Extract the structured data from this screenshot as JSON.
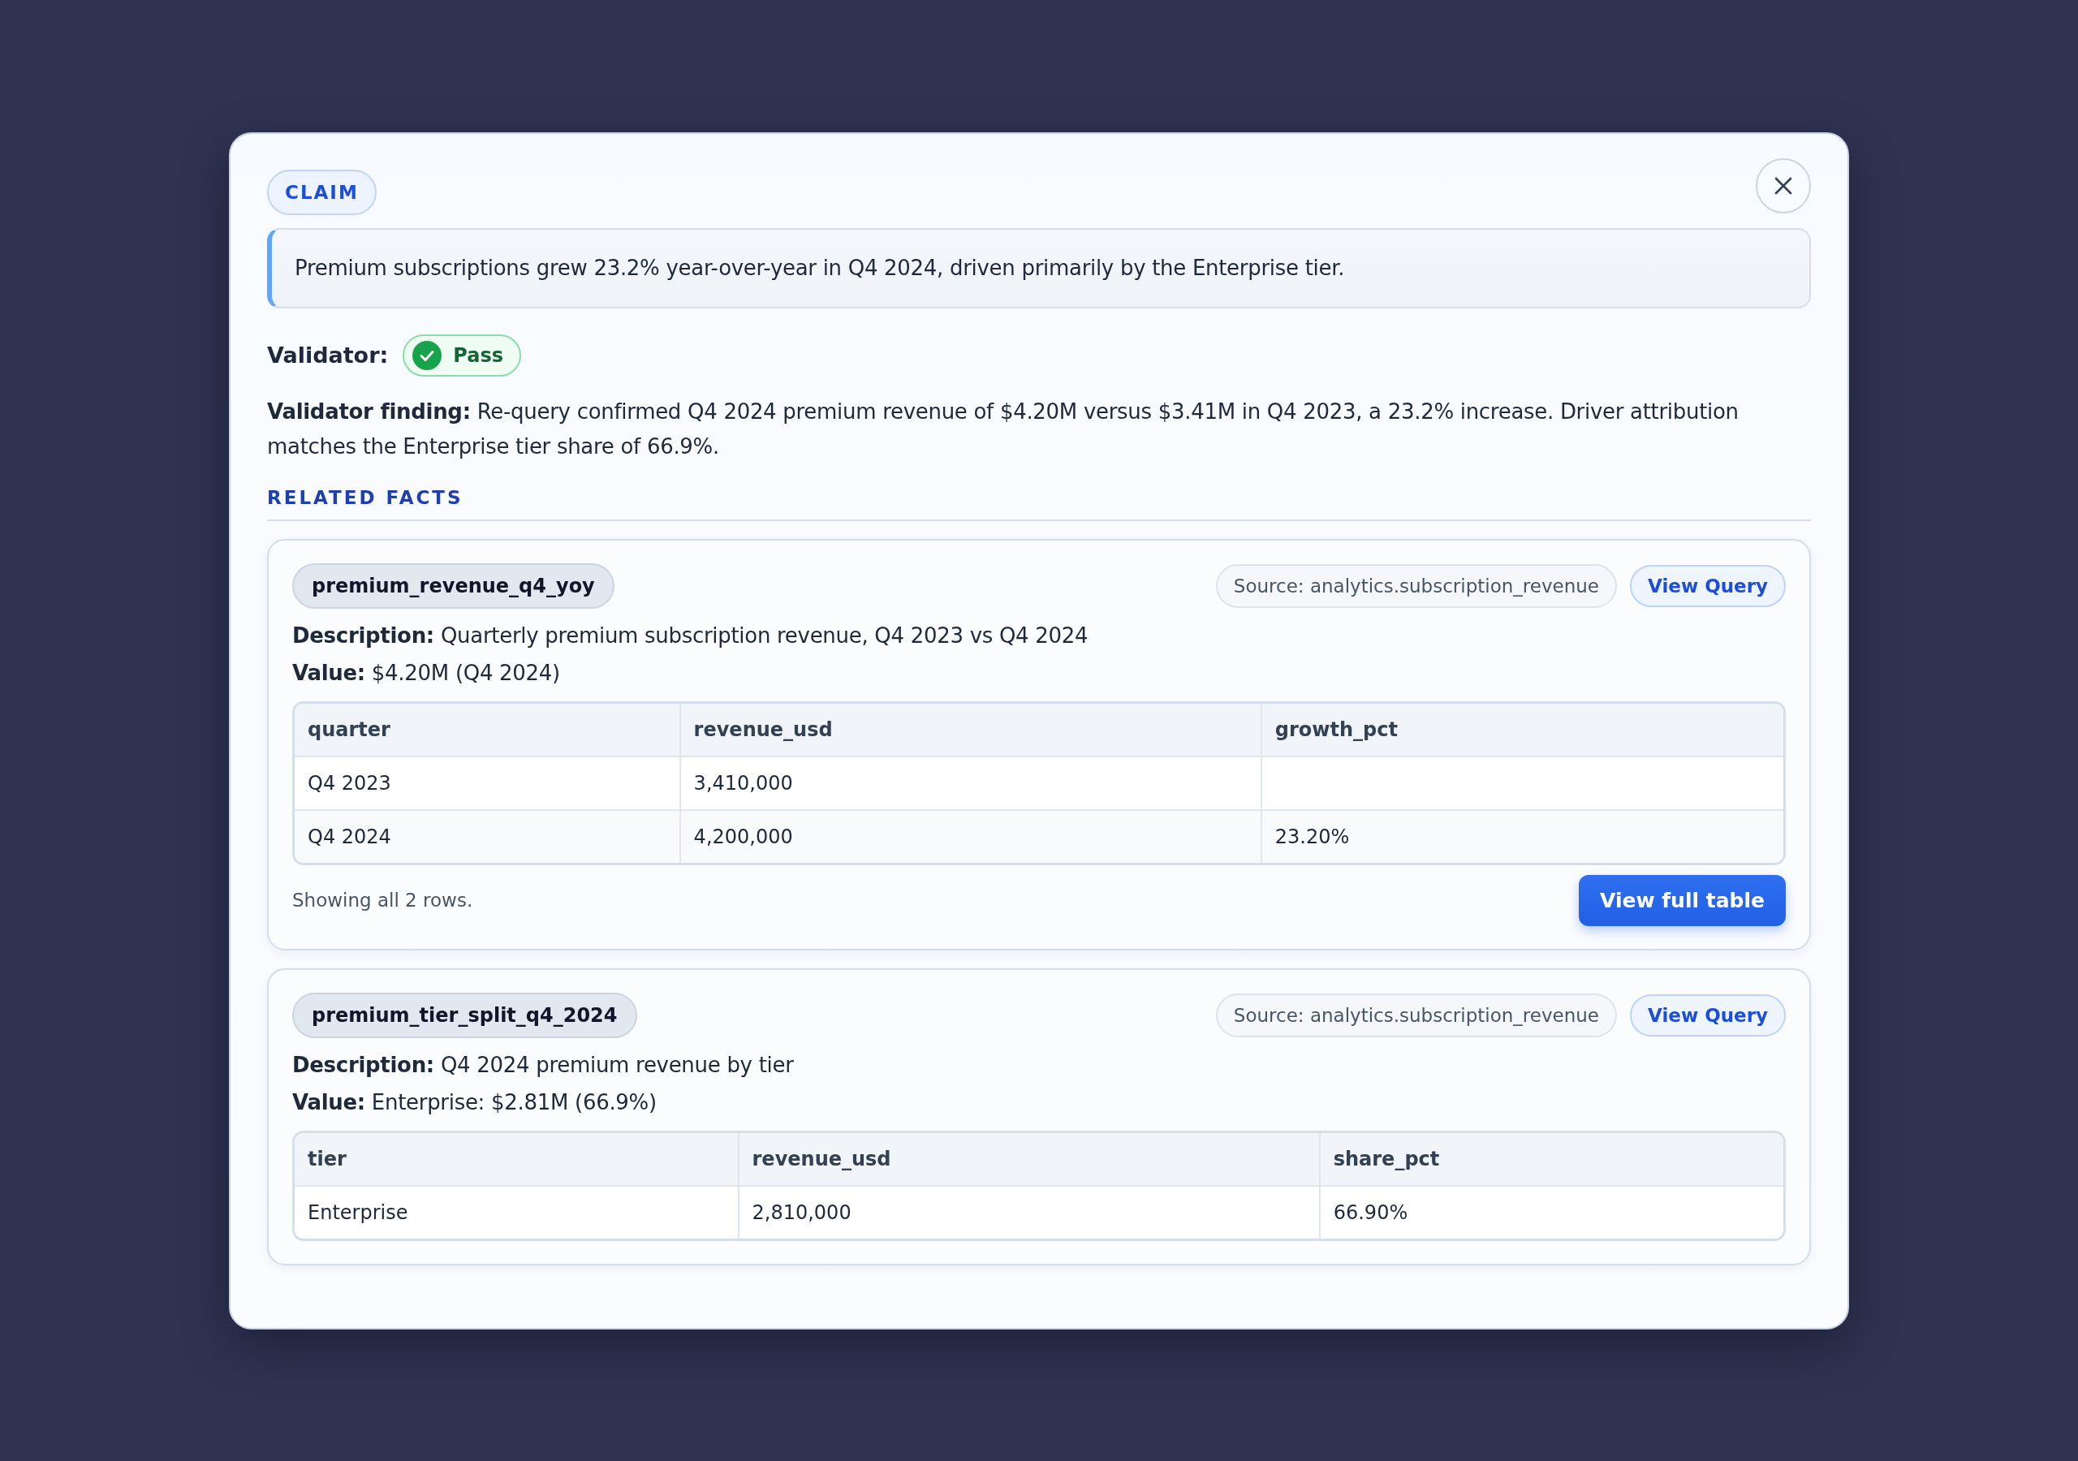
{
  "badge": "CLAIM",
  "claim": "Premium subscriptions grew 23.2% year-over-year in Q4 2024, driven primarily by the Enterprise tier.",
  "validator": {
    "label": "Validator:",
    "result": {
      "kind": "pass",
      "label": "Pass"
    }
  },
  "finding": "**Validator finding:** Re-query confirmed Q4 2024 premium revenue of $4.20M versus $3.41M in Q4 2023, a 23.2% increase. Driver attribution matches the Enterprise tier share of 66.9%.",
  "related_heading": "RELATED FACTS",
  "facts": [
    {
      "name": "premium_revenue_q4_yoy",
      "source": "Source: analytics.subscription_revenue",
      "query_button": "View Query",
      "description": "**Description:** Quarterly premium subscription revenue, Q4 2023 vs Q4 2024",
      "value": "**Value:** $4.20M (Q4 2024)",
      "table": {
        "columns": [
          "quarter",
          "revenue_usd",
          "growth_pct"
        ],
        "rows": [
          [
            "Q4 2023",
            "3,410,000",
            null
          ],
          [
            "Q4 2024",
            "4,200,000",
            "23.20%"
          ]
        ]
      },
      "footer_note": "Showing all 2 rows.",
      "full_table_button": "View full table"
    },
    {
      "name": "premium_tier_split_q4_2024",
      "source": "Source: analytics.subscription_revenue",
      "query_button": "View Query",
      "description": "**Description:** Q4 2024 premium revenue by tier",
      "value": "**Value:** Enterprise: $2.81M (66.9%)",
      "table": {
        "columns": [
          "tier",
          "revenue_usd",
          "share_pct"
        ],
        "rows": [
          [
            "Enterprise",
            "2,810,000",
            "66.90%"
          ]
        ]
      }
    }
  ]
}
